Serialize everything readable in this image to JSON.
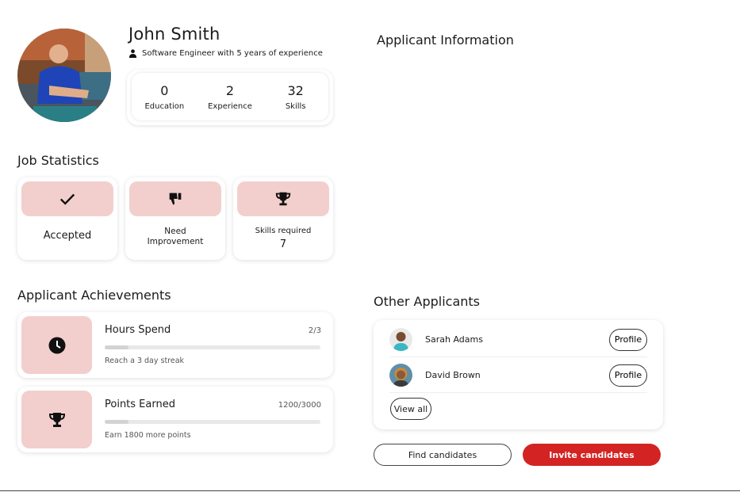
{
  "profile": {
    "name": "John Smith",
    "subtitle": "Software Engineer with 5 years of experience",
    "stats": [
      {
        "value": "0",
        "label": "Education"
      },
      {
        "value": "2",
        "label": "Experience"
      },
      {
        "value": "32",
        "label": "Skills"
      }
    ]
  },
  "applicant_info": {
    "title": "Applicant Information"
  },
  "job_statistics": {
    "title": "Job Statistics",
    "cards": [
      {
        "icon": "checkmark-icon",
        "label": "Accepted"
      },
      {
        "icon": "thumbs-down-icon",
        "label_line1": "Need",
        "label_line2": "Improvement"
      },
      {
        "icon": "trophy-icon",
        "label": "Skills required",
        "value": "7"
      }
    ]
  },
  "achievements": {
    "title": "Applicant Achievements",
    "items": [
      {
        "icon": "clock-icon",
        "title": "Hours Spend",
        "count": "2/3",
        "progress_fraction": 0.11,
        "description": "Reach a 3 day streak"
      },
      {
        "icon": "trophy-icon",
        "title": "Points Earned",
        "count": "1200/3000",
        "progress_fraction": 0.11,
        "description": "Earn 1800 more points"
      }
    ]
  },
  "other_applicants": {
    "title": "Other Applicants",
    "items": [
      {
        "name": "Sarah Adams",
        "button": "Profile"
      },
      {
        "name": "David Brown",
        "button": "Profile"
      }
    ],
    "view_all": "View all"
  },
  "actions": {
    "find": "Find candidates",
    "invite": "Invite candidates"
  },
  "colors": {
    "accent_pill": "#f2cfcd",
    "primary_button": "#d32323"
  }
}
